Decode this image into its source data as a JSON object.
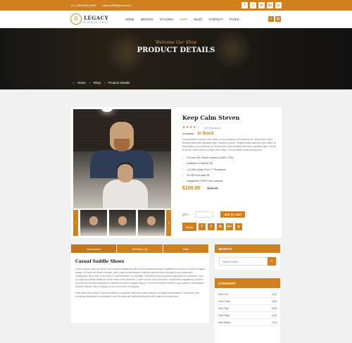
{
  "topbar": {
    "phone": "(+1) 980 (863) 6569",
    "email": "haircut488@gmail.com",
    "social": [
      "f",
      "t",
      "in",
      "G+",
      "p"
    ]
  },
  "brand": {
    "name": "LEGACY",
    "tagline": "BARBER SHOP",
    "mark": "B"
  },
  "nav": {
    "items": [
      "HOME",
      "SERVICE",
      "STYLERS",
      "SHOP",
      "BLOG",
      "CONTACT",
      "PAGES"
    ],
    "active": "SHOP",
    "icons": [
      "search-icon",
      "cart-icon"
    ]
  },
  "hero": {
    "subtitle": "Welcome Our Shop",
    "title": "PRODUCT DETAILS",
    "breadcrumb": [
      "Home",
      "Shop",
      "Product Details"
    ]
  },
  "product": {
    "name": "Keep Calm Steven",
    "stars": "★★★★☆",
    "reviews": "(06 Reviews)",
    "availability_label": "Available :",
    "availability_value": "In Stock",
    "description_1": "Suspendisse posuere arcu diam, id accumsan eros pharetra ac. Nulla enim risus, facilisis bibendum gravida eget, lacinia id purus. Suspendisse posuere arcu diam, id accumsan eros pharetra ac. Nulla enim risus facilisis bibendum gravida eget, lacinia id purus. Duis nullam pretium arcu diam, id accumsan eros pharetra ac.",
    "features": [
      "4.5 inch HD Touch Screen (1280 x 720)",
      "Android 4.4 KitKat OS",
      "1.4 GHz Quad Core™ Processor",
      "20 MP front and 28",
      "megapixel CMOS rear camera"
    ],
    "price_now": "$100.00",
    "price_old": "$98.00",
    "qty_label": "QTY :",
    "add_to_cart": "ADD TO CART",
    "share_label": "Share",
    "share_icons": [
      "f",
      "t",
      "in",
      "G+",
      "p"
    ]
  },
  "tabs": {
    "items": [
      "Description",
      "Reviews (3)",
      "Skils"
    ],
    "active": "Description"
  },
  "tab_content": {
    "title": "Casual Saddle Shoes",
    "p1": "Lorem ipsum dolor sit amet, consectetur adipisicing elit sed do eiusmod tempor incididunt ut labore et dolore magna aliqua. Ut enim ad minim veniam, quis nostrud exercitation ullamco laboris nisi ut aliquip ex ea commodo consequat. Duis aute irure dolor in reprehenderit in voluptate. Excepteur sint occaecat cupidatat non proident, sunt in culpa qui officia deserunt mollit anim id est laborum. Lorem ipsum dolor sit amet, consectetur adipisicing elit sed do eiusmod tempor incididunt ut labore et dolore magna aliqua. Ut enim ad minim veniam, quis nostrud exercitation ullamco laboris nisi ut aliquip ex ea commodo consequat.",
    "p2": "Duis aute irure dolor in reprehenderit in voluptate velit esse cillum dolore eu fugiat nulla pariatur. Excepteur sint occaecat cupidatat non proident, sunt in culpa qui officia deserunt mollit anim id est laborum."
  },
  "sidebar": {
    "search_title": "SEARCH",
    "search_placeholder": "Search Here...",
    "category_title": "CATEGORY",
    "categories": [
      {
        "name": "Hair Cut",
        "count": "(10)"
      },
      {
        "name": "Hair Color",
        "count": "(08)"
      },
      {
        "name": "Hair Dye",
        "count": "(06)"
      },
      {
        "name": "Hair Style",
        "count": "(18)"
      },
      {
        "name": "Hair Wash",
        "count": "(14)"
      }
    ]
  },
  "colors": {
    "accent": "#d0801f",
    "dark": "#1a1a1a",
    "bg": "#f1f1f1"
  }
}
